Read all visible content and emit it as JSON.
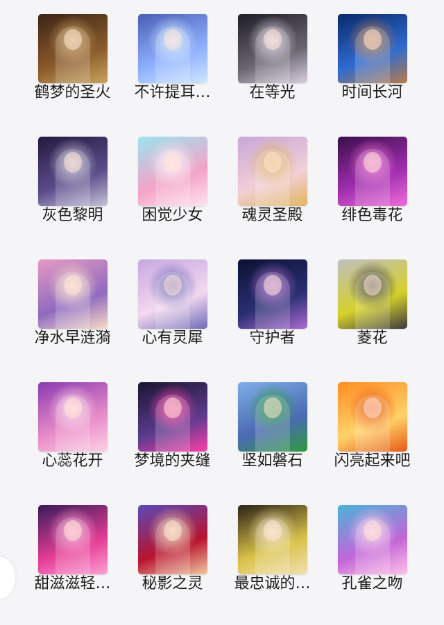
{
  "items": [
    {
      "title": "鹤梦的圣火",
      "art": "crowned-prince-dark",
      "colors": [
        "#3b2416",
        "#8a5a2b",
        "#c9a35e"
      ]
    },
    {
      "title": "不许提耳…",
      "art": "sleeping-girl-blue",
      "colors": [
        "#4a5fb5",
        "#8fb0ff",
        "#cfe6ff"
      ]
    },
    {
      "title": "在等光",
      "art": "couple-dark",
      "colors": [
        "#1e1e26",
        "#6a6470",
        "#d8cfe0"
      ]
    },
    {
      "title": "时间长河",
      "art": "clock-blue",
      "colors": [
        "#0a2a6a",
        "#2f6bd1",
        "#b87b4a"
      ]
    },
    {
      "title": "灰色黎明",
      "art": "dark-sorcerer",
      "colors": [
        "#231a3e",
        "#5a4c8a",
        "#c6c2d8"
      ]
    },
    {
      "title": "困觉少女",
      "art": "pink-fairy",
      "colors": [
        "#9be3ef",
        "#f4a3c7",
        "#ffe2ef"
      ]
    },
    {
      "title": "魂灵圣殿",
      "art": "blonde-girl-flower",
      "colors": [
        "#c9a6d8",
        "#f1cfd6",
        "#e2b560"
      ]
    },
    {
      "title": "绯色毒花",
      "art": "purple-dancer",
      "colors": [
        "#3a0e4a",
        "#a22fb0",
        "#f06dd8"
      ]
    },
    {
      "title": "净水早涟漪",
      "art": "couple-pink",
      "colors": [
        "#e59ac2",
        "#8f6ac0",
        "#f7dcc5"
      ]
    },
    {
      "title": "心有灵犀",
      "art": "white-haired-pair",
      "colors": [
        "#c7a8e2",
        "#f3d8ef",
        "#6e6bb8"
      ]
    },
    {
      "title": "守护者",
      "art": "witch-staff",
      "colors": [
        "#0b1233",
        "#2a2f73",
        "#ad6ad1"
      ]
    },
    {
      "title": "菱花",
      "art": "yellow-dress-child",
      "colors": [
        "#bfbfbf",
        "#d5d02a",
        "#3b3b3b"
      ]
    },
    {
      "title": "心蕊花开",
      "art": "queen-cake",
      "colors": [
        "#8a3ab1",
        "#e88cc8",
        "#ffd1e6"
      ]
    },
    {
      "title": "梦境的夹缝",
      "art": "black-cat",
      "colors": [
        "#1a1530",
        "#5b3b8e",
        "#ff3fa8"
      ]
    },
    {
      "title": "坚如磐石",
      "art": "blue-hair-boy",
      "colors": [
        "#7eaee6",
        "#4a6ab3",
        "#2f9b3e"
      ]
    },
    {
      "title": "闪亮起来吧",
      "art": "blonde-profile",
      "colors": [
        "#ff8c22",
        "#ffd36a",
        "#e85a18"
      ]
    },
    {
      "title": "甜滋滋轻…",
      "art": "pink-princess",
      "colors": [
        "#3a1b5a",
        "#e33d94",
        "#ff9fd4"
      ]
    },
    {
      "title": "秘影之灵",
      "art": "red-dress-girl",
      "colors": [
        "#5b4ab8",
        "#b8142f",
        "#f1c8a0"
      ]
    },
    {
      "title": "最忠诚的…",
      "art": "blonde-warrior",
      "colors": [
        "#2b2116",
        "#d9c24a",
        "#f2e0b2"
      ]
    },
    {
      "title": "孔雀之吻",
      "art": "peacock-queen",
      "colors": [
        "#4ab3d9",
        "#c266d8",
        "#ffc1e8"
      ]
    }
  ]
}
